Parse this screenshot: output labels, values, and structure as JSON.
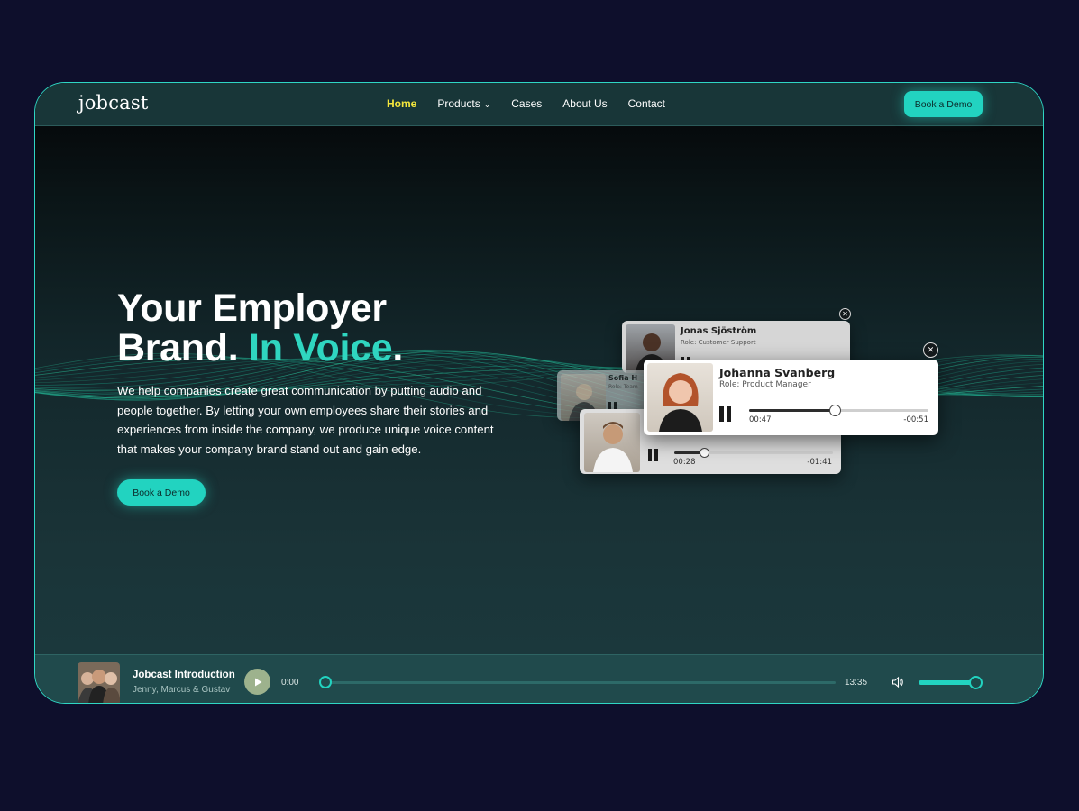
{
  "nav": {
    "logo": "jobcast",
    "items": [
      {
        "label": "Home",
        "active": true
      },
      {
        "label": "Products",
        "has_dropdown": true
      },
      {
        "label": "Cases"
      },
      {
        "label": "About Us"
      },
      {
        "label": "Contact"
      }
    ],
    "cta": "Book a Demo"
  },
  "hero": {
    "title_line1": "Your Employer",
    "title_line2_a": "Brand.",
    "title_line2_b": "In Voice",
    "title_line2_c": ".",
    "text": "We help companies create great communication by putting audio and people together. By letting your own employees share their stories and experiences from inside the company, we produce unique voice content that makes your company brand stand out and gain edge.",
    "cta": "Book a Demo"
  },
  "cards": {
    "jonas": {
      "name": "Jonas Sjöström",
      "role": "Role: Customer Support"
    },
    "sofia": {
      "name": "Sofia H",
      "role": "Role: Team"
    },
    "johanna": {
      "name": "Johanna Svanberg",
      "role": "Role: Product Manager",
      "elapsed": "00:47",
      "remaining": "-00:51",
      "progress": 0.48
    },
    "small": {
      "elapsed": "00:28",
      "remaining": "-01:41",
      "progress": 0.19
    }
  },
  "player": {
    "title": "Jobcast Introduction",
    "subtitle": "Jenny, Marcus & Gustav",
    "current": "0:00",
    "duration": "13:35",
    "progress": 0,
    "volume": 0.85
  },
  "colors": {
    "accent": "#22d3c0",
    "active_nav": "#f3e63d",
    "page_bg": "#0e0f2c"
  },
  "icons": [
    "chevron-down-icon",
    "close-icon",
    "pause-icon",
    "play-icon",
    "volume-icon"
  ]
}
